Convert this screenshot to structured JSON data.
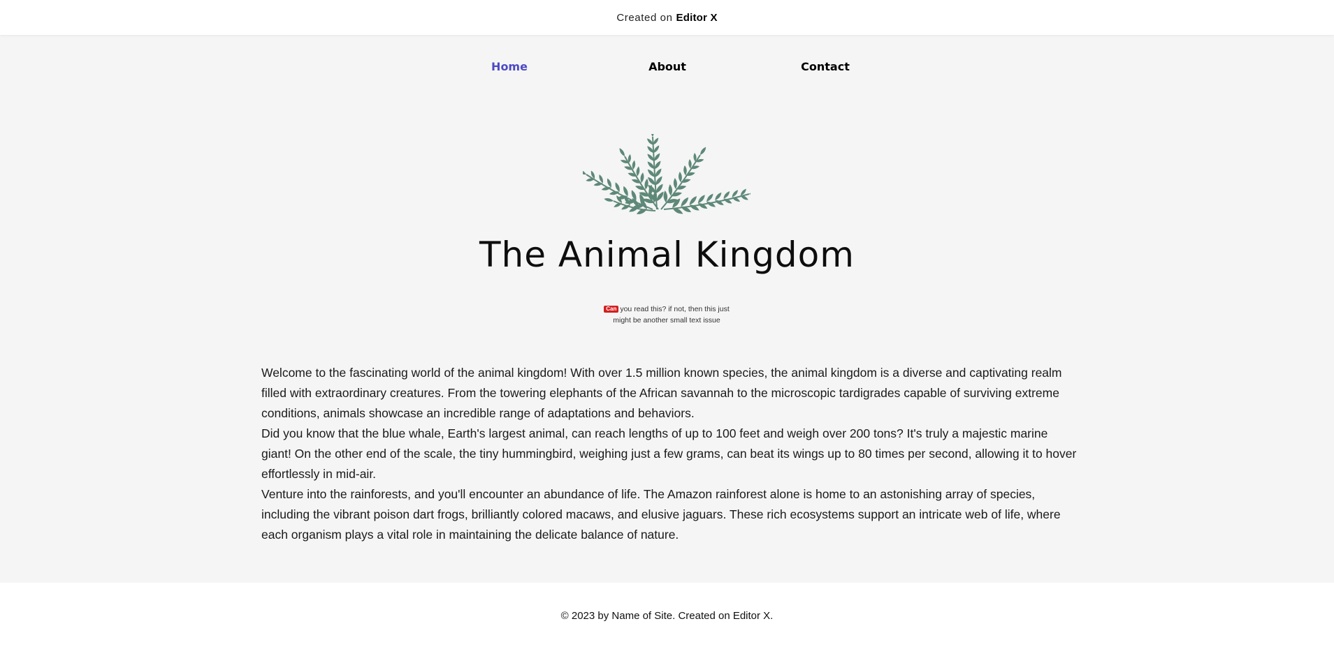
{
  "topbar": {
    "prefix": "Created on",
    "brand": "Editor X"
  },
  "nav": [
    {
      "label": "Home",
      "active": true
    },
    {
      "label": "About",
      "active": false
    },
    {
      "label": "Contact",
      "active": false
    }
  ],
  "hero": {
    "logo_icon": "leaf-branches-icon",
    "title": "The Animal Kingdom",
    "small_badge": "Can",
    "small_text": "you read this? if not, then this just might be another small text issue"
  },
  "content": {
    "paragraphs": [
      "Welcome to the fascinating world of the animal kingdom! With over 1.5 million known species, the animal kingdom is a diverse and captivating realm filled with extraordinary creatures. From the towering elephants of the African savannah to the microscopic tardigrades capable of surviving extreme conditions, animals showcase an incredible range of adaptations and behaviors.",
      "Did you know that the blue whale, Earth's largest animal, can reach lengths of up to 100 feet and weigh over 200 tons? It's truly a majestic marine giant! On the other end of the scale, the tiny hummingbird, weighing just a few grams, can beat its wings up to 80 times per second, allowing it to hover effortlessly in mid-air.",
      "Venture into the rainforests, and you'll encounter an abundance of life. The Amazon rainforest alone is home to an astonishing array of species, including the vibrant poison dart frogs, brilliantly colored macaws, and elusive jaguars. These rich ecosystems support an intricate web of life, where each organism plays a vital role in maintaining the delicate balance of nature."
    ]
  },
  "footer": {
    "text": "© 2023 by Name of Site. Created on Editor X."
  },
  "colors": {
    "accent": "#4d4ac4",
    "leaf": "#5e8878",
    "background": "#f5f5f5",
    "badge": "#d41f1f"
  }
}
